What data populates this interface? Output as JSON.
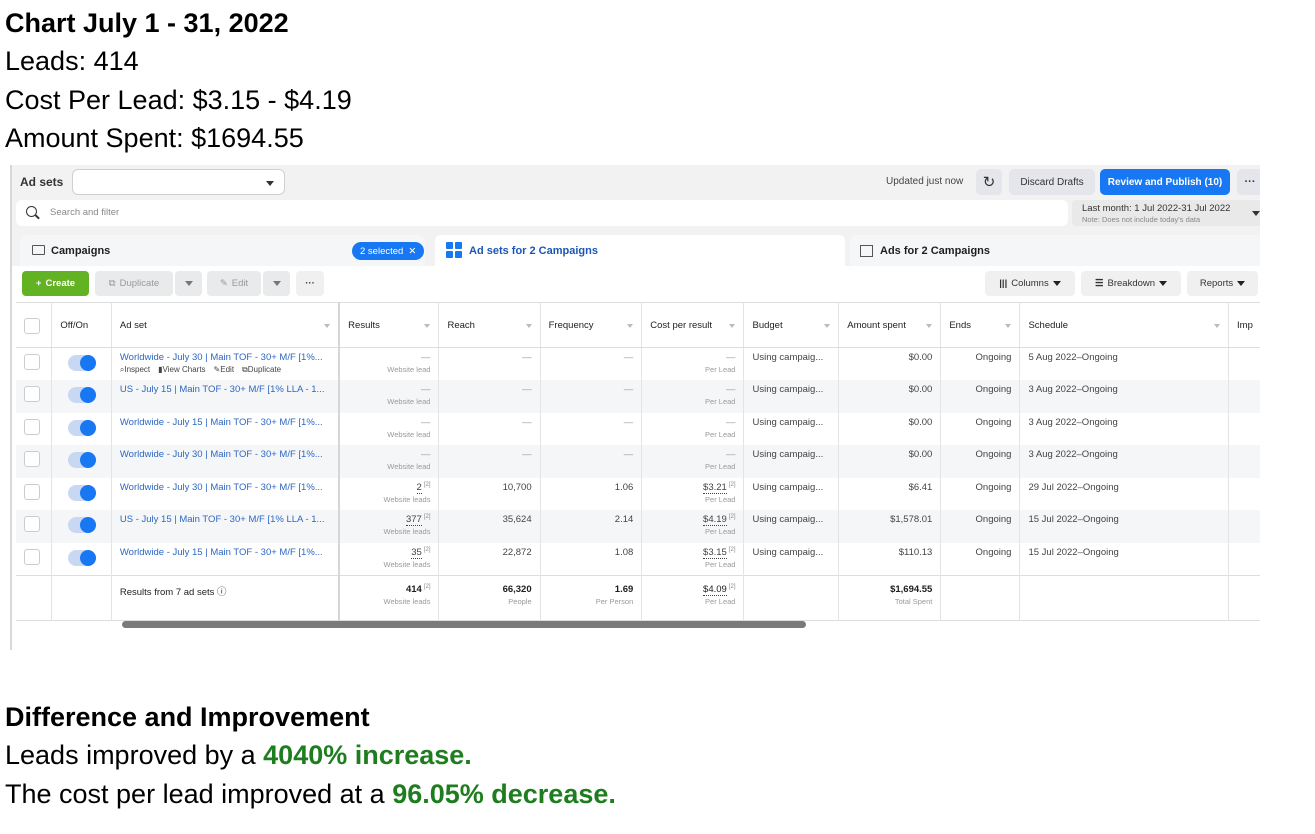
{
  "summary": {
    "title": "Chart July 1 - 31, 2022",
    "leads": "Leads: 414",
    "cost_per_lead": "Cost Per Lead: $3.15 - $4.19",
    "amount_spent": "Amount Spent: $1694.55"
  },
  "topbar": {
    "level_label": "Ad sets",
    "level_select_value": "",
    "updated": "Updated just now",
    "refresh_icon": "refresh-icon",
    "discard_label": "Discard Drafts",
    "publish_label": "Review and Publish (10)",
    "more_label": "···"
  },
  "search": {
    "placeholder": "Search and filter",
    "date_range": "Last month: 1 Jul 2022-31 Jul 2022",
    "date_note": "Note: Does not include today's data"
  },
  "tabs": [
    {
      "label": "Campaigns",
      "icon": "folder-icon",
      "badge": "2 selected",
      "active": false
    },
    {
      "label": "Ad sets for 2 Campaigns",
      "icon": "grid-icon",
      "active": true
    },
    {
      "label": "Ads for 2 Campaigns",
      "icon": "ad-icon",
      "active": false
    }
  ],
  "toolbar": {
    "create": "Create",
    "duplicate": "Duplicate",
    "edit": "Edit",
    "more": "···",
    "columns": "Columns",
    "breakdown": "Breakdown",
    "reports": "Reports"
  },
  "table": {
    "columns": [
      "Off/On",
      "Ad set",
      "Results",
      "Reach",
      "Frequency",
      "Cost per result",
      "Budget",
      "Amount spent",
      "Ends",
      "Schedule",
      "Imp"
    ],
    "row_actions": [
      "Inspect",
      "View Charts",
      "Edit",
      "Duplicate"
    ],
    "rows": [
      {
        "name": "Worldwide - July 30 | Main TOF - 30+ M/F [1%...",
        "on": true,
        "results": "—",
        "results_sub": "Website lead",
        "reach": "—",
        "frequency": "—",
        "cpr": "—",
        "cpr_sub": "Per Lead",
        "budget": "Using campaig...",
        "spent": "$0.00",
        "ends": "Ongoing",
        "schedule": "5 Aug 2022–Ongoing"
      },
      {
        "name": "US - July 15 | Main TOF - 30+ M/F [1% LLA - 1...",
        "on": true,
        "results": "—",
        "results_sub": "Website lead",
        "reach": "—",
        "frequency": "—",
        "cpr": "—",
        "cpr_sub": "Per Lead",
        "budget": "Using campaig...",
        "spent": "$0.00",
        "ends": "Ongoing",
        "schedule": "3 Aug 2022–Ongoing"
      },
      {
        "name": "Worldwide - July 15 | Main TOF - 30+ M/F [1%...",
        "on": true,
        "results": "—",
        "results_sub": "Website lead",
        "reach": "—",
        "frequency": "—",
        "cpr": "—",
        "cpr_sub": "Per Lead",
        "budget": "Using campaig...",
        "spent": "$0.00",
        "ends": "Ongoing",
        "schedule": "3 Aug 2022–Ongoing"
      },
      {
        "name": "Worldwide - July 30 | Main TOF - 30+ M/F [1%...",
        "on": true,
        "results": "—",
        "results_sub": "Website lead",
        "reach": "—",
        "frequency": "—",
        "cpr": "—",
        "cpr_sub": "Per Lead",
        "budget": "Using campaig...",
        "spent": "$0.00",
        "ends": "Ongoing",
        "schedule": "3 Aug 2022–Ongoing"
      },
      {
        "name": "Worldwide - July 30 | Main TOF - 30+ M/F [1%...",
        "on": true,
        "results": "2",
        "results_sub": "Website leads",
        "reach": "10,700",
        "frequency": "1.06",
        "cpr": "$3.21",
        "cpr_sub": "Per Lead",
        "budget": "Using campaig...",
        "spent": "$6.41",
        "ends": "Ongoing",
        "schedule": "29 Jul 2022–Ongoing"
      },
      {
        "name": "US - July 15 | Main TOF - 30+ M/F [1% LLA - 1...",
        "on": true,
        "results": "377",
        "results_sub": "Website leads",
        "reach": "35,624",
        "frequency": "2.14",
        "cpr": "$4.19",
        "cpr_sub": "Per Lead",
        "budget": "Using campaig...",
        "spent": "$1,578.01",
        "ends": "Ongoing",
        "schedule": "15 Jul 2022–Ongoing"
      },
      {
        "name": "Worldwide - July 15 | Main TOF - 30+ M/F [1%...",
        "on": true,
        "results": "35",
        "results_sub": "Website leads",
        "reach": "22,872",
        "frequency": "1.08",
        "cpr": "$3.15",
        "cpr_sub": "Per Lead",
        "budget": "Using campaig...",
        "spent": "$110.13",
        "ends": "Ongoing",
        "schedule": "15 Jul 2022–Ongoing"
      }
    ],
    "superscript": "[2]",
    "totals": {
      "label": "Results from 7 ad sets",
      "results": "414",
      "results_sub": "Website leads",
      "reach": "66,320",
      "reach_sub": "People",
      "frequency": "1.69",
      "frequency_sub": "Per Person",
      "cpr": "$4.09",
      "cpr_sub": "Per Lead",
      "spent": "$1,694.55",
      "spent_sub": "Total Spent"
    }
  },
  "difference": {
    "title": "Difference and Improvement",
    "leads_prefix": "Leads improved by a ",
    "leads_highlight": "4040% increase.",
    "cpl_prefix": "The cost per lead improved at a ",
    "cpl_highlight": "96.05% decrease.",
    "highlight_color": "#1e7d1e"
  }
}
